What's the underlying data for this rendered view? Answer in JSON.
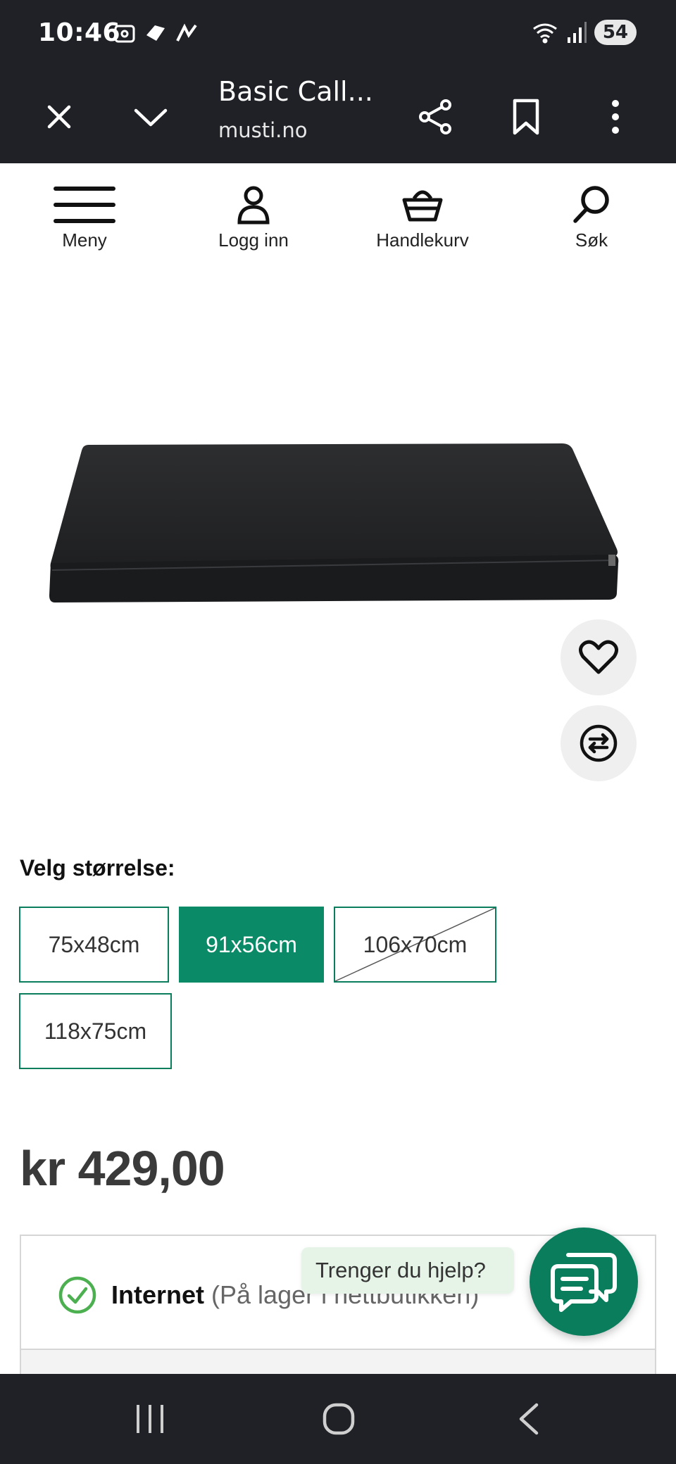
{
  "status_bar": {
    "time": "10:46",
    "battery": "54",
    "left_icons": [
      "screenshot-icon",
      "app-notification-icon",
      "app-notification-icon"
    ],
    "right_icons": [
      "wifi-icon",
      "signal-icon"
    ]
  },
  "browser": {
    "title": "Basic Call...",
    "url": "musti.no",
    "buttons": [
      "close-icon",
      "chevron-down-icon",
      "share-icon",
      "bookmark-icon",
      "more-vertical-icon"
    ]
  },
  "header": {
    "menu_label": "Meny",
    "login_label": "Logg inn",
    "cart_label": "Handlekurv",
    "search_label": "Søk"
  },
  "product": {
    "image_description_icon": "dog-mattress-image",
    "favorite_icon": "heart-icon",
    "compare_icon": "compare-icon",
    "size_heading": "Velg størrelse:",
    "sizes": [
      {
        "label": "75x48cm",
        "state": "available"
      },
      {
        "label": "91x56cm",
        "state": "selected"
      },
      {
        "label": "106x70cm",
        "state": "unavailable"
      },
      {
        "label": "118x75cm",
        "state": "available"
      }
    ],
    "price": "kr 429,00"
  },
  "availability": {
    "channel": "Internet",
    "note": "(På lager i nettbutikken)"
  },
  "help": {
    "bubble_text": "Trenger du hjelp?",
    "chat_icon": "chat-icon"
  },
  "colors": {
    "brand_green": "#0a8a67",
    "dark_bar": "#1f2126",
    "check_green": "#4caf50"
  },
  "nav_bar": [
    "recent-apps-icon",
    "home-icon",
    "back-icon"
  ]
}
